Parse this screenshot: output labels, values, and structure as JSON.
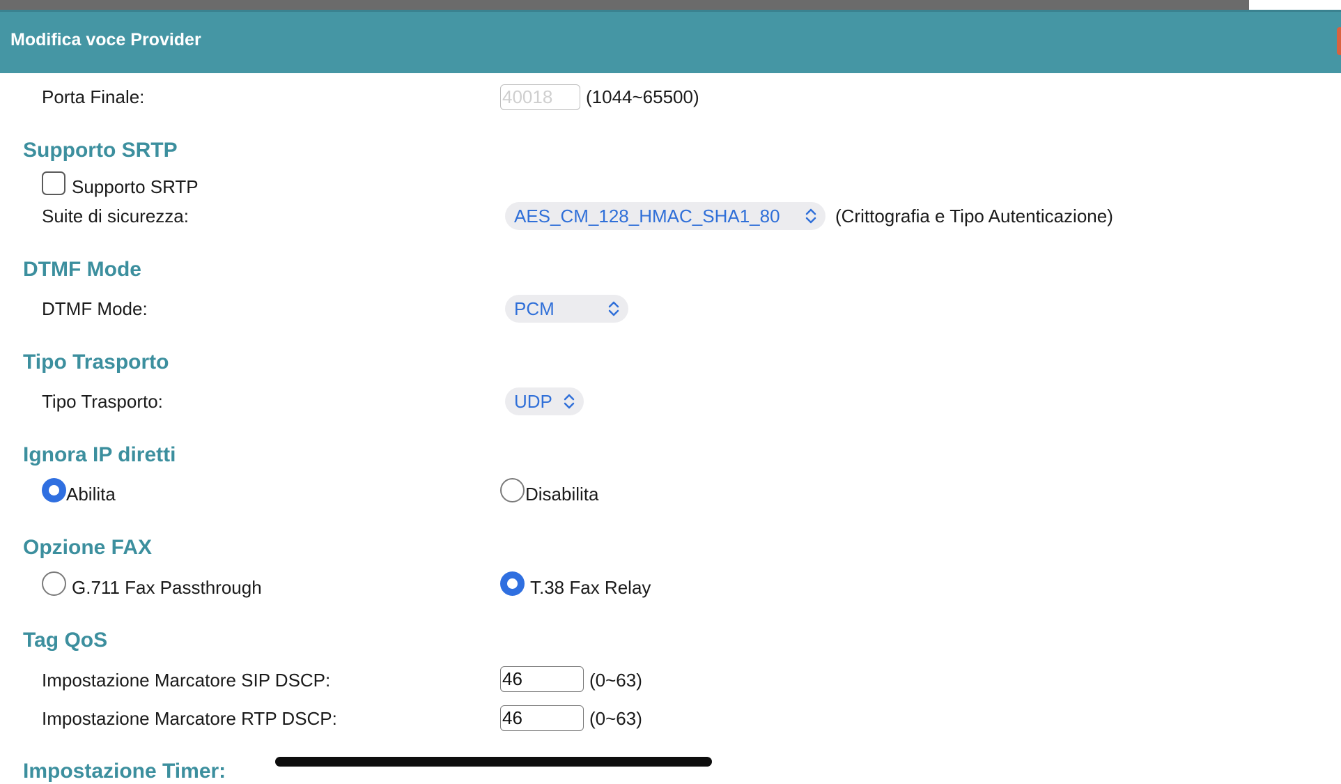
{
  "window": {
    "title": "Modifica voce Provider"
  },
  "porta_finale": {
    "label": "Porta Finale:",
    "value": "40018",
    "range": "(1044~65500)"
  },
  "srtp": {
    "section_title": "Supporto SRTP",
    "checkbox_label": "Supporto SRTP",
    "checked": false,
    "suite_label": "Suite di sicurezza:",
    "suite_value": "AES_CM_128_HMAC_SHA1_80",
    "suite_hint": "(Crittografia e Tipo Autenticazione)"
  },
  "dtmf": {
    "section_title": "DTMF Mode",
    "label": "DTMF Mode:",
    "value": "PCM"
  },
  "trasporto": {
    "section_title": "Tipo Trasporto",
    "label": "Tipo Trasporto:",
    "value": "UDP"
  },
  "ignora_ip": {
    "section_title": "Ignora IP diretti",
    "option_enable": "Abilita",
    "option_disable": "Disabilita",
    "selected": "Abilita"
  },
  "fax": {
    "section_title": "Opzione FAX",
    "option_g711": "G.711 Fax Passthrough",
    "option_t38": "T.38 Fax Relay",
    "selected": "T.38 Fax Relay"
  },
  "qos": {
    "section_title": "Tag QoS",
    "sip_label": "Impostazione Marcatore SIP DSCP:",
    "sip_value": "46",
    "sip_range": "(0~63)",
    "rtp_label": "Impostazione Marcatore RTP DSCP:",
    "rtp_value": "46",
    "rtp_range": "(0~63)"
  },
  "timer": {
    "section_title": "Impostazione Timer:"
  },
  "colors": {
    "header_bg": "#4596a4",
    "section_title": "#3c8f9e",
    "select_text": "#2f6fd8",
    "radio_selected": "#2f6fe0"
  }
}
